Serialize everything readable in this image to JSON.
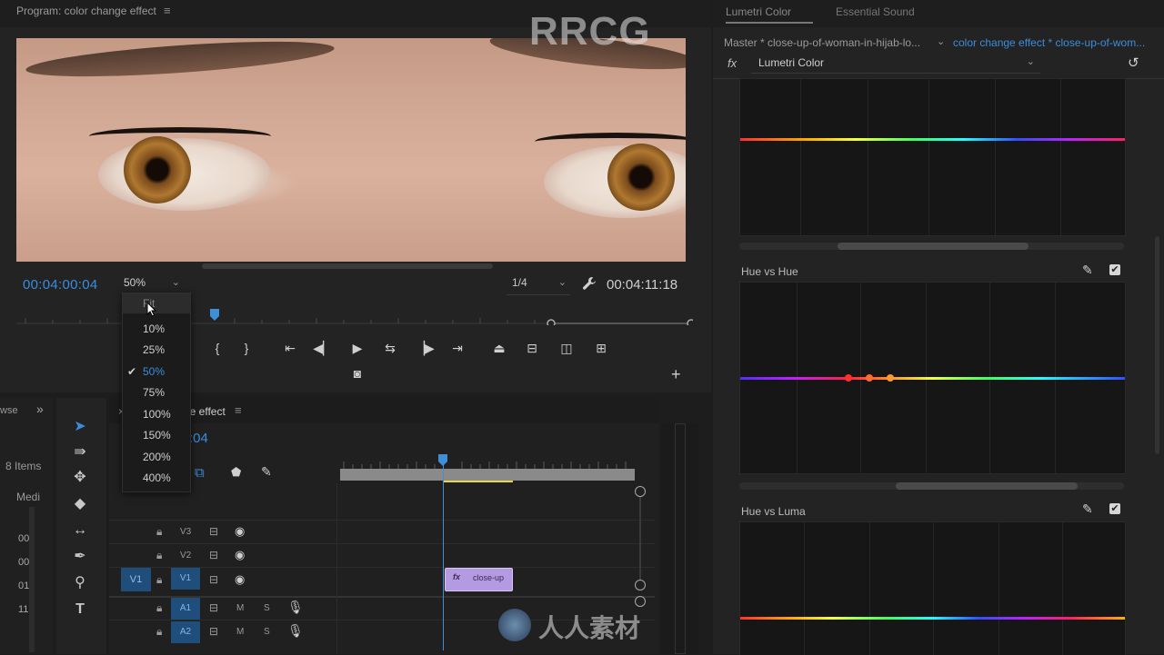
{
  "program": {
    "title": "Program: color change effect",
    "menu_glyph": "≡",
    "timecode_current": "00:04:00:04",
    "zoom_value": "50%",
    "resolution": "1/4",
    "timecode_duration": "00:04:11:18",
    "zoom_options": [
      {
        "label": "Fit",
        "selected": false
      },
      {
        "label": "10%",
        "selected": false
      },
      {
        "label": "25%",
        "selected": false
      },
      {
        "label": "50%",
        "selected": true
      },
      {
        "label": "75%",
        "selected": false
      },
      {
        "label": "100%",
        "selected": false
      },
      {
        "label": "150%",
        "selected": false
      },
      {
        "label": "200%",
        "selected": false
      },
      {
        "label": "400%",
        "selected": false
      }
    ],
    "check_glyph": "✔"
  },
  "project": {
    "tab_fragment": "wse",
    "expand_glyph": "»",
    "items_count": "8 Items",
    "column_header": "Medi",
    "rows": [
      "00",
      "00",
      "01",
      "11"
    ]
  },
  "timeline": {
    "tab_label": "ge effect",
    "menu_glyph": "≡",
    "timecode_fragment": ":04",
    "tracks": [
      {
        "name": "V3"
      },
      {
        "name": "V2"
      },
      {
        "name": "V1"
      },
      {
        "name": "A1",
        "m": "M",
        "s": "S"
      },
      {
        "name": "A2",
        "m": "M",
        "s": "S"
      }
    ],
    "source_patch": "V1",
    "clip": {
      "fx": "fx",
      "name": "close-up"
    }
  },
  "lumetri": {
    "tab_labels": [
      "Lumetri Color",
      "Essential Sound"
    ],
    "master_label": "Master * close-up-of-woman-in-hijab-lo...",
    "effect_label": "color change effect * close-up-of-wom...",
    "fx_label": "fx",
    "effect_name": "Lumetri Color",
    "sections": [
      {
        "title": "Hue vs Hue"
      },
      {
        "title": "Hue vs Luma"
      }
    ],
    "checkmark": "✔"
  },
  "watermark": {
    "top": "RRCG",
    "bottom": "人人素材"
  }
}
